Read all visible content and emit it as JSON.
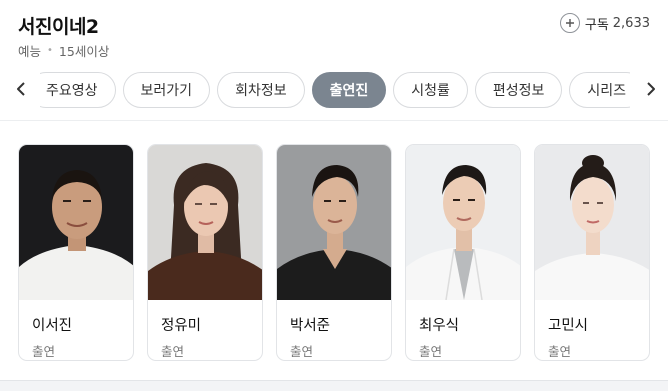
{
  "header": {
    "title": "서진이네2",
    "genre": "예능",
    "rating": "15세이상",
    "subscribe_label": "구독",
    "subscribe_count": "2,633"
  },
  "tabs": [
    {
      "label": "주요영상",
      "active": false
    },
    {
      "label": "보러가기",
      "active": false
    },
    {
      "label": "회차정보",
      "active": false
    },
    {
      "label": "출연진",
      "active": true
    },
    {
      "label": "시청률",
      "active": false
    },
    {
      "label": "편성정보",
      "active": false
    },
    {
      "label": "시리즈",
      "active": false
    }
  ],
  "cast": [
    {
      "name": "이서진",
      "role": "출연"
    },
    {
      "name": "정유미",
      "role": "출연"
    },
    {
      "name": "박서준",
      "role": "출연"
    },
    {
      "name": "최우식",
      "role": "출연"
    },
    {
      "name": "고민시",
      "role": "출연"
    }
  ],
  "icons": {
    "prev": "chevron-left-icon",
    "next": "chevron-right-icon",
    "subscribe": "plus-icon"
  },
  "colors": {
    "active_tab_bg": "#7b8590",
    "card_border": "#e2e4e7"
  }
}
